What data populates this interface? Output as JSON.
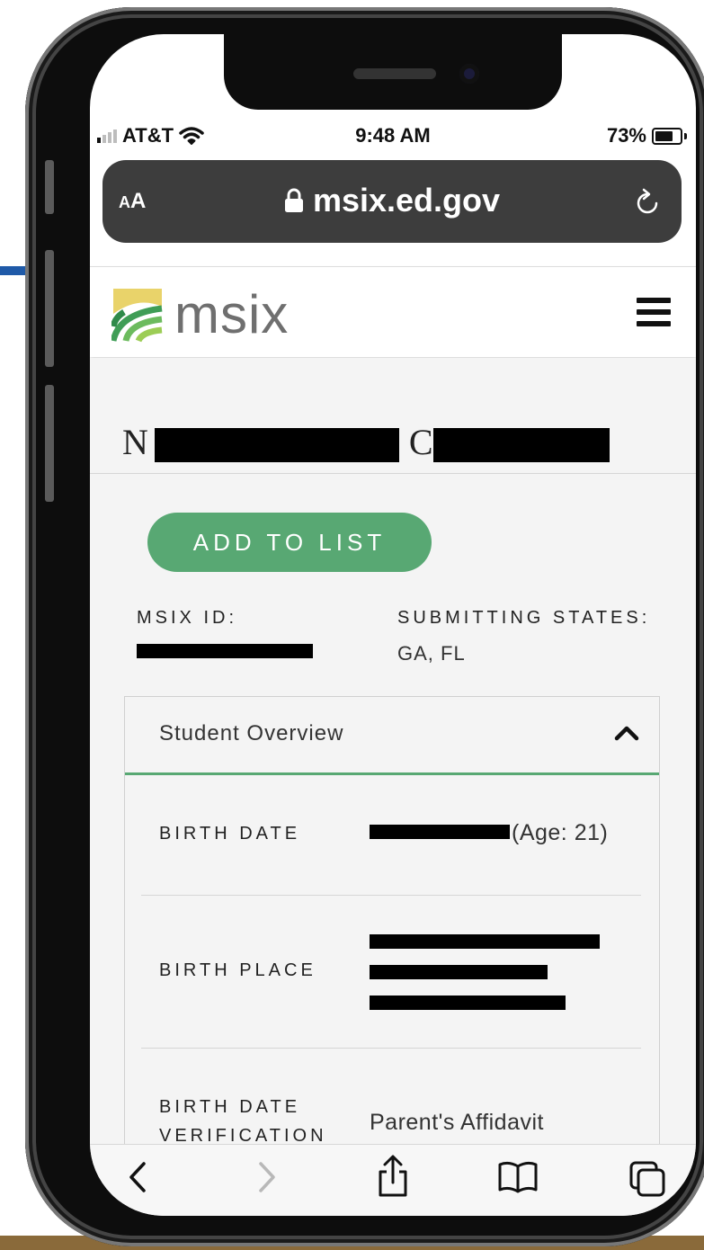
{
  "status_bar": {
    "carrier": "AT&T",
    "time": "9:48 AM",
    "battery": "73%",
    "battery_level": 0.73,
    "icons": [
      "signal-icon",
      "wifi-icon",
      "battery-icon"
    ]
  },
  "browser": {
    "text_size_label": "A",
    "text_size_label_large": "A",
    "url": "msix.ed.gov",
    "icons": [
      "lock-icon",
      "reload-icon"
    ]
  },
  "site_header": {
    "logo_text": "msix",
    "icons": [
      "msix-logo-icon",
      "hamburger-menu-icon"
    ]
  },
  "student": {
    "name_initial_first": "N",
    "name_initial_last": "C",
    "add_to_list_label": "ADD TO LIST",
    "msix_id_label": "MSIX ID:",
    "submitting_states_label": "SUBMITTING STATES:",
    "submitting_states_value": "GA, FL"
  },
  "overview": {
    "title": "Student Overview",
    "rows": [
      {
        "label": "BIRTH DATE",
        "value": "(Age: 21)"
      },
      {
        "label": "BIRTH PLACE",
        "value": ""
      },
      {
        "label_line1": "BIRTH DATE",
        "label_line2": "VERIFICATION",
        "value": "Parent's Affidavit"
      }
    ]
  },
  "toolbar": {
    "icons": [
      "back-icon",
      "forward-icon",
      "share-icon",
      "bookmarks-icon",
      "tabs-icon"
    ]
  },
  "colors": {
    "accent_green": "#58a873",
    "url_bar": "#3d3d3d",
    "frame": "#0d0d0d"
  }
}
